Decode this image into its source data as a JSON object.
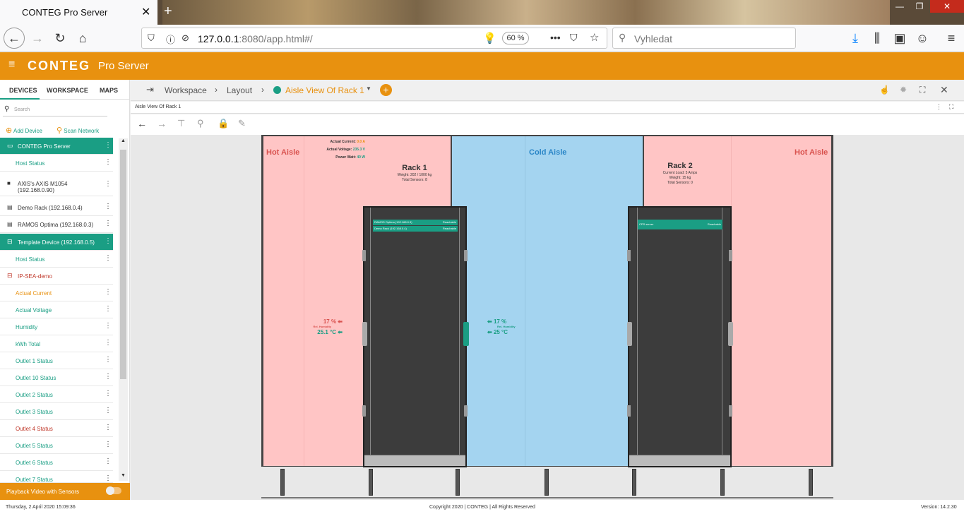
{
  "browser": {
    "tab_title": "CONTEG Pro Server",
    "url_host": "127.0.0.1",
    "url_rest": ":8080/app.html#/",
    "zoom": "60 %",
    "search_placeholder": "Vyhledat"
  },
  "app": {
    "logo": "CONTEG",
    "product": "Pro Server"
  },
  "sidebar": {
    "tabs": [
      "DEVICES",
      "WORKSPACE",
      "MAPS"
    ],
    "search_placeholder": "Search",
    "add_device": "Add Device",
    "scan_network": "Scan Network",
    "items": [
      {
        "label": "CONTEG Pro Server"
      },
      {
        "label": "Host Status"
      },
      {
        "label": "AXIS's AXIS M1054"
      },
      {
        "label": "(192.168.0.90)"
      },
      {
        "label": "Demo Rack (192.168.0.4)"
      },
      {
        "label": "RAMOS Optima (192.168.0.3)"
      },
      {
        "label": "Template Device (192.168.0.5)"
      },
      {
        "label": "Host Status"
      },
      {
        "label": "IP-SEA-demo"
      },
      {
        "label": "Actual Current"
      },
      {
        "label": "Actual Voltage"
      },
      {
        "label": "Humidity"
      },
      {
        "label": "kWh Total"
      },
      {
        "label": "Outlet 1 Status"
      },
      {
        "label": "Outlet 10 Status"
      },
      {
        "label": "Outlet 2 Status"
      },
      {
        "label": "Outlet 3 Status"
      },
      {
        "label": "Outlet 4 Status"
      },
      {
        "label": "Outlet 5 Status"
      },
      {
        "label": "Outlet 6 Status"
      },
      {
        "label": "Outlet 7 Status"
      }
    ],
    "playback": "Playback Video with Sensors"
  },
  "breadcrumb": {
    "workspace": "Workspace",
    "layout": "Layout",
    "current": "Aisle View Of Rack 1"
  },
  "panel": {
    "title": "Aisle View Of Rack 1"
  },
  "scene": {
    "hot_aisle_left": "Hot Aisle",
    "cold_aisle": "Cold Aisle",
    "hot_aisle_right": "Hot Aisle",
    "actual_current_label": "Actual Current:",
    "actual_current_value": "0.0 A",
    "actual_voltage_label": "Actual Voltage:",
    "actual_voltage_value": "235.3 V",
    "power_watt_label": "Power Watt:",
    "power_watt_value": "40 W",
    "rack1": {
      "title": "Rack 1",
      "weight": "Weight: 202 / 1000 kg",
      "sensors": "Total Sensors: 8",
      "devices": [
        {
          "name": "RAMOS Optima (192.168.0.3)",
          "status": "Reachable"
        },
        {
          "name": "Demo Rack (192.168.0.4)",
          "status": "Reachable"
        }
      ]
    },
    "rack2": {
      "title": "Rack 2",
      "load": "Current Load: 5 Amps",
      "weight": "Weight: 15 kg",
      "sensors": "Total Sensors: 0",
      "devices": [
        {
          "name": "CPS server",
          "status": "Reachable"
        }
      ]
    },
    "hot_sensor": {
      "humidity": "17 %",
      "humidity_label": "Rel. Humidity",
      "temp": "25.1 °C"
    },
    "cold_sensor": {
      "humidity": "17 %",
      "humidity_label": "Rel. Humidity",
      "temp": "25 °C"
    }
  },
  "footer": {
    "date": "Thursday, 2 April 2020 15:09:36",
    "copyright": "Copyright 2020 | CONTEG | All Rights Reserved",
    "version": "Version: 14.2.30"
  },
  "colors": {
    "accent": "#e8910f",
    "teal": "#1a9e84",
    "hot": "#ffc5c5",
    "cold": "#a4d4f0"
  }
}
